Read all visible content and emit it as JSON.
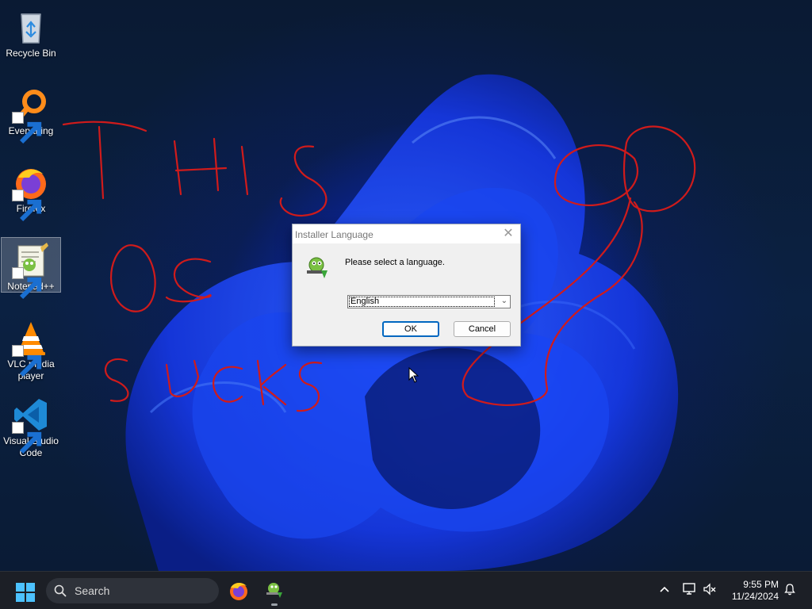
{
  "desktop": {
    "icons": [
      {
        "label": "Recycle Bin",
        "icon": "recycle-bin-icon"
      },
      {
        "label": "Everything",
        "icon": "everything-search-icon"
      },
      {
        "label": "Firefox",
        "icon": "firefox-icon"
      },
      {
        "label": "Notepad++",
        "icon": "notepad-plus-plus-icon"
      },
      {
        "label": "VLC media player",
        "icon": "vlc-icon"
      },
      {
        "label": "Visual Studio Code",
        "icon": "vscode-icon"
      }
    ],
    "scribble_text": "THIS OS SUCKS",
    "scribble_color": "#d01b1b"
  },
  "dialog": {
    "title": "Installer Language",
    "close_label": "✕",
    "prompt": "Please select a language.",
    "language_selected": "English",
    "ok_label": "OK",
    "cancel_label": "Cancel",
    "accent": "#0067c0"
  },
  "taskbar": {
    "search_label": "Search",
    "time": "9:55 PM",
    "date": "11/24/2024",
    "apps": [
      "firefox-icon",
      "notepad-plus-plus-icon"
    ],
    "tray": [
      "chevron-up-icon",
      "network-icon",
      "volume-muted-icon",
      "notification-bell-icon"
    ]
  }
}
